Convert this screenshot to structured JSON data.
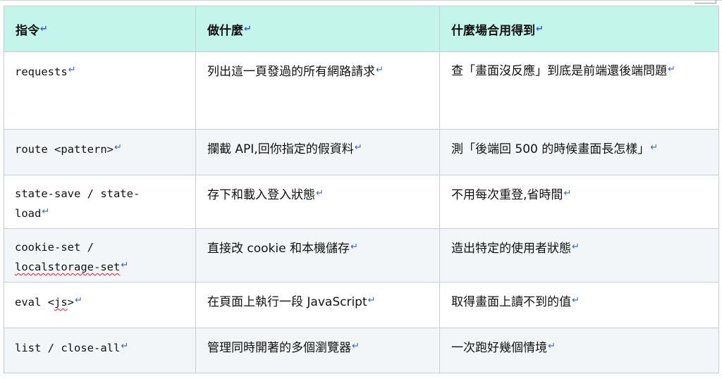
{
  "table": {
    "headers": [
      "指令",
      "做什麼",
      "什麼場合用得到"
    ],
    "return_mark": "↵",
    "rows": [
      {
        "command": "requests",
        "what": "列出這一頁發過的所有網路請求",
        "when": "查「畫面沒反應」到底是前端還後端問題"
      },
      {
        "command": "route <pattern>",
        "what": "攔截 API,回你指定的假資料",
        "when": "測「後端回 500 的時候畫面長怎樣」"
      },
      {
        "command_line1": "state-save / state-",
        "command_line2": "load",
        "what": "存下和載入登入狀態",
        "when": "不用每次重登,省時間"
      },
      {
        "command_line1": "cookie-set /",
        "command_line2": "localstorage-set",
        "what": "直接改 cookie 和本機儲存",
        "when": "造出特定的使用者狀態"
      },
      {
        "command_pre": "eval <",
        "command_mid": "js",
        "command_post": ">",
        "what": "在頁面上執行一段 JavaScript",
        "when": "取得畫面上讀不到的值"
      },
      {
        "command": "list / close-all",
        "what": "管理同時開著的多個瀏覽器",
        "when": "一次跑好幾個情境"
      }
    ]
  }
}
